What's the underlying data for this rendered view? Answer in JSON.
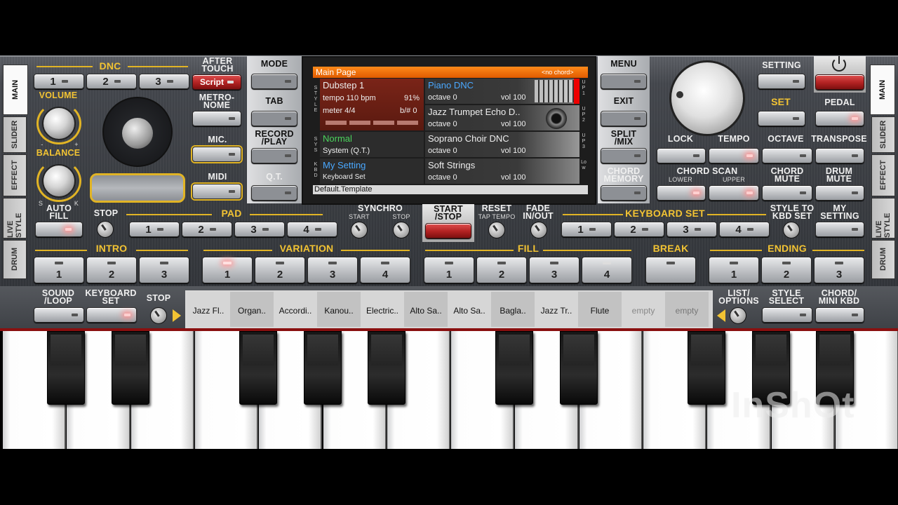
{
  "tabs_left": [
    "MAIN",
    "SLIDER",
    "EFFECT",
    "LIVE STYLE",
    "DRUM"
  ],
  "tabs_right": [
    "MAIN",
    "SLIDER",
    "EFFECT",
    "LIVE STYLE",
    "DRUM"
  ],
  "dnc": {
    "title": "DNC",
    "buttons": [
      "1",
      "2",
      "3"
    ]
  },
  "after_touch": {
    "label": "AFTER TOUCH",
    "button": "Script"
  },
  "volume": "VOLUME",
  "balance": "BALANCE",
  "balance_s": "S",
  "balance_k": "K",
  "knob_minus": "-",
  "knob_plus": "+",
  "auto_fill": "AUTO FILL",
  "metronome": "METRO- NOME",
  "mic": "MIC.",
  "midi": "MIDI",
  "mode": "MODE",
  "tab": "TAB",
  "record_play": "RECORD /PLAY",
  "qt": "Q.T.",
  "menu": "MENU",
  "exit": "EXIT",
  "split_mix": "SPLIT /MIX",
  "chord_memory": "CHORD MEMORY",
  "setting": "SETTING",
  "set": "SET",
  "pedal": "PEDAL",
  "lock": "LOCK",
  "tempo": "TEMPO",
  "octave": "OCTAVE",
  "transpose": "TRANSPOSE",
  "chord_scan": "CHORD SCAN",
  "lower": "LOWER",
  "upper": "UPPER",
  "chord_mute": "CHORD MUTE",
  "drum_mute": "DRUM MUTE",
  "display": {
    "header": "Main Page",
    "no_chord": "<no chord>",
    "style": {
      "name": "Dubstep 1",
      "tempo": "tempo 110 bpm",
      "percent": "91%",
      "meter": "meter 4/4",
      "bsharp": "b/# 0"
    },
    "sys": {
      "name": "Normal",
      "sub": "System (Q.T.)"
    },
    "kbd": {
      "name": "My Setting",
      "sub": "Keyboard Set"
    },
    "footer": "Default.Template",
    "side_style": "STYLE",
    "side_sys": "SYS",
    "side_kbd": "KBD",
    "parts": [
      {
        "name": "Piano DNC",
        "octave": "octave  0",
        "vol": "vol 100",
        "tag": "UP1"
      },
      {
        "name": "Jazz Trumpet Echo D..",
        "octave": "octave  0",
        "vol": "vol 100",
        "tag": "UP2"
      },
      {
        "name": "Soprano Choir DNC",
        "octave": "octave  0",
        "vol": "vol 100",
        "tag": "UP3"
      },
      {
        "name": "Soft Strings",
        "octave": "octave  0",
        "vol": "vol 100",
        "tag": "Low"
      }
    ]
  },
  "stop": "STOP",
  "pad": {
    "title": "PAD",
    "buttons": [
      "1",
      "2",
      "3",
      "4"
    ]
  },
  "synchro": {
    "title": "SYNCHRO",
    "start": "START",
    "stop": "STOP"
  },
  "start_stop": "START /STOP",
  "reset": "RESET",
  "tap_tempo": "TAP TEMPO",
  "fade": "FADE IN/OUT",
  "keyboard_set": {
    "title": "KEYBOARD SET",
    "buttons": [
      "1",
      "2",
      "3",
      "4"
    ]
  },
  "style_to_kbd": "STYLE TO KBD SET",
  "my_setting": "MY SETTING",
  "intro": {
    "title": "INTRO",
    "buttons": [
      "1",
      "2",
      "3"
    ]
  },
  "variation": {
    "title": "VARIATION",
    "buttons": [
      "1",
      "2",
      "3",
      "4"
    ]
  },
  "fill": {
    "title": "FILL",
    "buttons": [
      "1",
      "2",
      "3",
      "4"
    ]
  },
  "break": "BREAK",
  "ending": {
    "title": "ENDING",
    "buttons": [
      "1",
      "2",
      "3"
    ]
  },
  "sound_loop": "SOUND /LOOP",
  "keyboard_set_btn": "KEYBOARD SET",
  "stop2": "STOP",
  "sounds": [
    "Jazz Fl..",
    "Organ..",
    "Accordi..",
    "Kanou..",
    "Electric..",
    "Alto Sa..",
    "Alto Sa..",
    "Bagla..",
    "Jazz Tr..",
    "Flute",
    "empty",
    "empty"
  ],
  "list_options": "LIST/ OPTIONS",
  "style_select": "STYLE SELECT",
  "chord_mini": "CHORD/ MINI KBD",
  "watermark": "InShOt"
}
